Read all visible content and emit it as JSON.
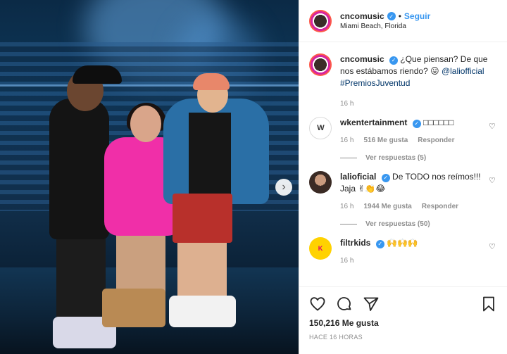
{
  "post": {
    "username": "cncomusic",
    "separator": "•",
    "follow_label": "Seguir",
    "location": "Miami Beach, Florida",
    "caption": "¿Que piensan? De que nos estábamos riendo? 😛",
    "mention": "@laliofficial",
    "hashtag": "#PremiosJuventud",
    "caption_age": "16 h"
  },
  "comments": [
    {
      "username": "wkentertainment",
      "text": "□□□□□□",
      "age": "16 h",
      "likes": "516 Me gusta",
      "reply_label": "Responder",
      "view_replies": "Ver respuestas (5)"
    },
    {
      "username": "lalioficial",
      "text": "De TODO nos reímos!!! Jaja ✌👏😂",
      "age": "16 h",
      "likes": "1944 Me gusta",
      "reply_label": "Responder",
      "view_replies": "Ver respuestas (50)"
    },
    {
      "username": "filtrkids",
      "text": "🙌🙌🙌",
      "age": "16 h"
    }
  ],
  "footer": {
    "likes": "150,216 Me gusta",
    "time": "HACE 16 HORAS"
  },
  "colors": {
    "accent": "#3897f0",
    "link": "#003569",
    "muted": "#8e8e8e",
    "text": "#262626"
  }
}
